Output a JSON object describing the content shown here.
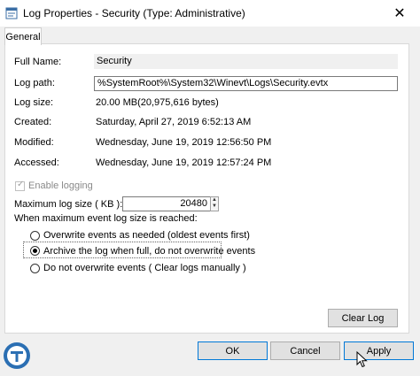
{
  "window": {
    "title": "Log Properties - Security (Type: Administrative)",
    "close_glyph": "✕"
  },
  "tabs": [
    {
      "label": "General"
    }
  ],
  "fields": {
    "full_name": {
      "label": "Full Name:",
      "value": "Security"
    },
    "log_path": {
      "label": "Log path:",
      "value": "%SystemRoot%\\System32\\Winevt\\Logs\\Security.evtx"
    },
    "log_size": {
      "label": "Log size:",
      "value": "20.00 MB(20,975,616 bytes)"
    },
    "created": {
      "label": "Created:",
      "value": "Saturday, April 27, 2019 6:52:13 AM"
    },
    "modified": {
      "label": "Modified:",
      "value": "Wednesday, June 19, 2019 12:56:50 PM"
    },
    "accessed": {
      "label": "Accessed:",
      "value": "Wednesday, June 19, 2019 12:57:24 PM"
    }
  },
  "enable_logging": {
    "label": "Enable logging",
    "checked": true,
    "disabled": true
  },
  "max_log_size": {
    "label": "Maximum log size ( KB ):",
    "value": "20480"
  },
  "when_reached_label": "When maximum event log size is reached:",
  "retention_options": [
    {
      "label": "Overwrite events as needed (oldest events first)",
      "selected": false
    },
    {
      "label": "Archive the log when full, do not overwrite events",
      "selected": true
    },
    {
      "label": "Do not overwrite events ( Clear logs manually )",
      "selected": false
    }
  ],
  "buttons": {
    "clear_log": "Clear Log",
    "ok": "OK",
    "cancel": "Cancel",
    "apply": "Apply"
  },
  "icons": {
    "title": "log-properties-icon",
    "close": "close-icon",
    "watermark": "windows-club-logo",
    "cursor": "mouse-cursor-icon"
  }
}
